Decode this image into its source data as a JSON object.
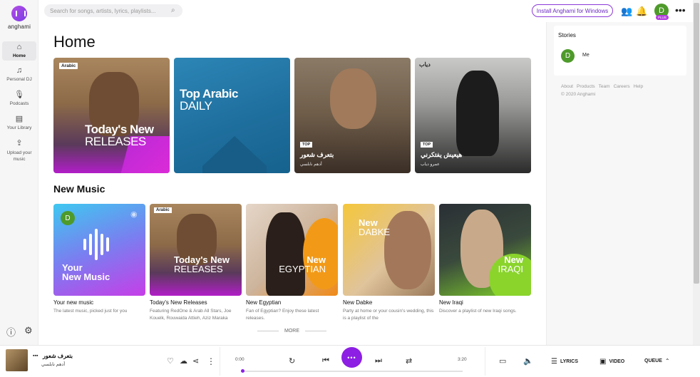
{
  "sidebar": {
    "logo_text": "anghami",
    "items": [
      {
        "label": "Home",
        "icon": "home-icon",
        "glyph": "⌂"
      },
      {
        "label": "Personal DJ",
        "icon": "headphones-icon",
        "glyph": "♫"
      },
      {
        "label": "Podcasts",
        "icon": "microphone-icon",
        "glyph": "🎙"
      },
      {
        "label": "Your Library",
        "icon": "library-icon",
        "glyph": "▤"
      },
      {
        "label": "Upload your music",
        "icon": "upload-icon",
        "glyph": "⇪"
      }
    ]
  },
  "topbar": {
    "search_placeholder": "Search for songs, artists, lyrics, playlists...",
    "install_label": "Install Anghami for Windows",
    "avatar_letter": "D",
    "plus_badge": "PLUS"
  },
  "main": {
    "title": "Home",
    "featured": [
      {
        "tag": "Arabic",
        "line1": "Today's New",
        "line2": "RELEASES"
      },
      {
        "line1": "Top Arabic",
        "line2": "DAILY"
      },
      {
        "tag": "TOP",
        "title": "بتعرف شعور",
        "subtitle": "أدهم نابلسي"
      },
      {
        "tag": "TOP",
        "title": "هيعيش يفتكرني",
        "subtitle": "عمرو دياب",
        "logo": "دياب"
      }
    ],
    "new_music_title": "New Music",
    "new_music": [
      {
        "name": "Your new music",
        "desc": "The latest music, picked just for you",
        "cover_line1": "Your",
        "cover_line2": "New Music",
        "avatar": "D"
      },
      {
        "name": "Today's New Releases",
        "desc": "Featuring RedOne & Arab All Stars, Joe Kouelk, Rouwaida Attieh, Aziz Maraka",
        "tag": "Arabic",
        "cover_line1": "Today's New",
        "cover_line2": "RELEASES"
      },
      {
        "name": "New Egyptian",
        "desc": "Fan of Egyptian? Enjoy these latest releases.",
        "cover_line1": "New",
        "cover_line2": "EGYPTIAN"
      },
      {
        "name": "New Dabke",
        "desc": "Party at home or your cousin's wedding, this is a playlist of the",
        "cover_line1": "New",
        "cover_line2": "DABKE"
      },
      {
        "name": "New Iraqi",
        "desc": "Discover a playlist of new Iraqi songs.",
        "cover_line1": "New",
        "cover_line2": "IRAQI"
      }
    ],
    "more_label": "MORE"
  },
  "right_panel": {
    "stories_title": "Stories",
    "story_user": "Me",
    "story_avatar": "D",
    "footer_links": [
      "About",
      "Products",
      "Team",
      "Careers",
      "Help"
    ],
    "copyright": "© 2020 Anghami"
  },
  "player": {
    "now_playing_title": "بتعرف شعور",
    "now_playing_artist": "أدهم نابلسي",
    "time_elapsed": "0:00",
    "time_total": "3:20",
    "progress": 0,
    "lyrics_label": "LYRICS",
    "video_label": "VIDEO",
    "queue_label": "QUEUE",
    "play_glyph": "•••"
  },
  "colors": {
    "accent": "#8c1fe3",
    "avatar_green": "#4e9a2a"
  }
}
